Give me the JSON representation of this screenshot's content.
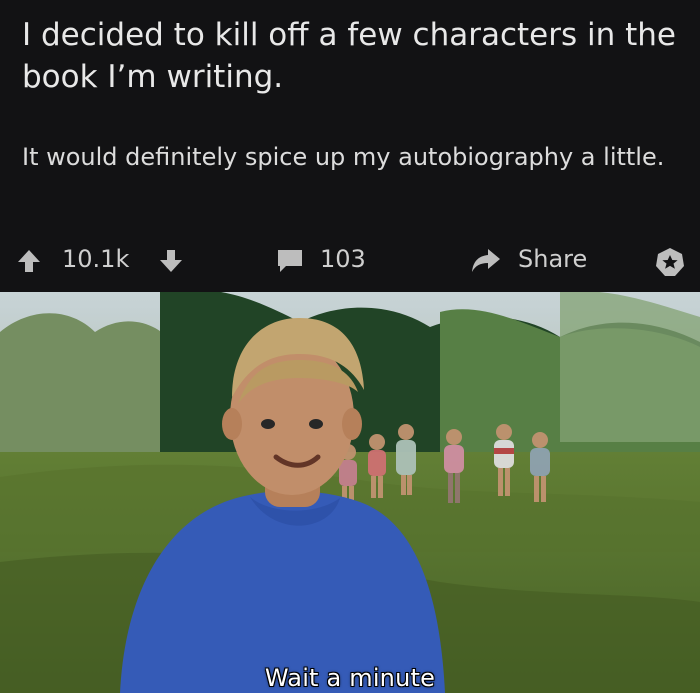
{
  "post": {
    "title": "I decided to kill off a few characters in the book I’m writing.",
    "body": "It would definitely spice up my autobiography a little.",
    "votes": "10.1k",
    "comments": "103",
    "share_label": "Share"
  },
  "media": {
    "caption": "Wait a minute"
  },
  "icons": {
    "upvote": "arrow-up-icon",
    "downvote": "arrow-down-icon",
    "comment": "comment-icon",
    "share": "share-icon",
    "award": "award-icon"
  },
  "colors": {
    "background": "#121214",
    "text": "#e8e8e8",
    "icon": "#bdbdbd"
  }
}
